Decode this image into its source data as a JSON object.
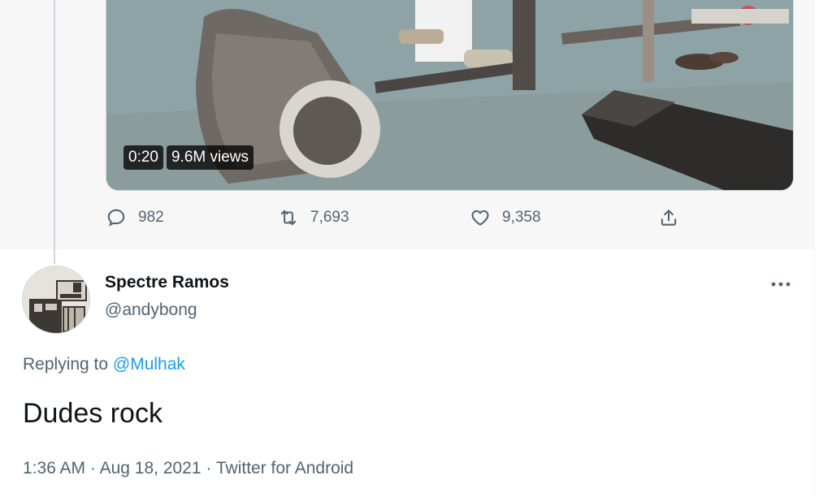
{
  "video": {
    "duration": "0:20",
    "views": "9.6M views"
  },
  "parent_actions": {
    "reply_count": "982",
    "retweet_count": "7,693",
    "like_count": "9,358",
    "icons": [
      "reply-icon",
      "retweet-icon",
      "like-icon",
      "share-icon"
    ]
  },
  "reply": {
    "author_name": "Spectre Ramos",
    "author_handle": "@andybong",
    "replying_prefix": "Replying to",
    "replying_to": "@Mulhak",
    "text": "Dudes rock",
    "time": "1:36 AM",
    "date": "Aug 18, 2021",
    "source": "Twitter for Android",
    "separator": "·"
  },
  "colors": {
    "link": "#1d9bf0",
    "secondary_text": "#536471",
    "primary_text": "#0f1419",
    "thread_line": "#cfd9de"
  }
}
